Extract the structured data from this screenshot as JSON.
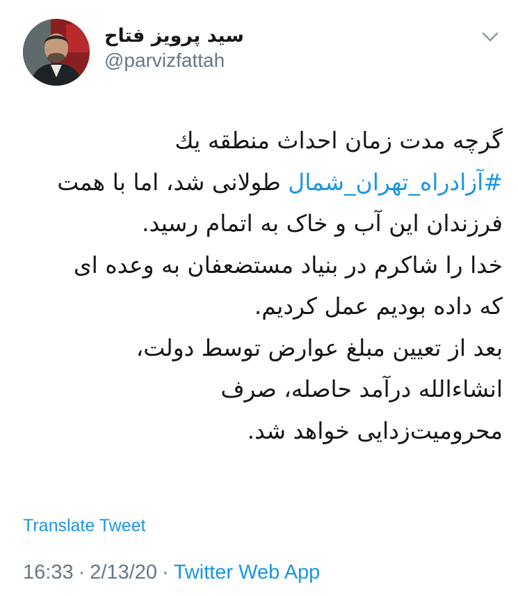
{
  "tweet": {
    "author": {
      "display_name": "سید پرویز فتاح",
      "handle": "@parvizfattah",
      "avatar_icon": "profile-photo"
    },
    "menu_icon": "chevron-down-icon",
    "body_lines": [
      {
        "text": "گرچه مدت زمان احداث منطقه یك"
      },
      {
        "hashtag": "#آزادراه_تهران_شمال",
        "text": " طولانی شد، اما با همت"
      },
      {
        "text": "فرزندان این آب و خاک به اتمام رسید."
      },
      {
        "text": "خدا را شاکرم در بنیاد مستضعفان به وعده ای"
      },
      {
        "text": "که داده بودیم عمل کردیم."
      },
      {
        "text": "بعد از تعیین مبلغ عوارض توسط دولت،"
      },
      {
        "text": "انشاءالله درآمد حاصله، صرف"
      },
      {
        "text": "محرومیت‌زدایی خواهد شد."
      }
    ],
    "translate_label": "Translate Tweet",
    "time": "16:33",
    "date": "2/13/20",
    "separator": "·",
    "source": "Twitter Web App"
  },
  "colors": {
    "link": "#1b95e0",
    "text": "#14171a",
    "secondary": "#657786",
    "background": "#ffffff"
  }
}
